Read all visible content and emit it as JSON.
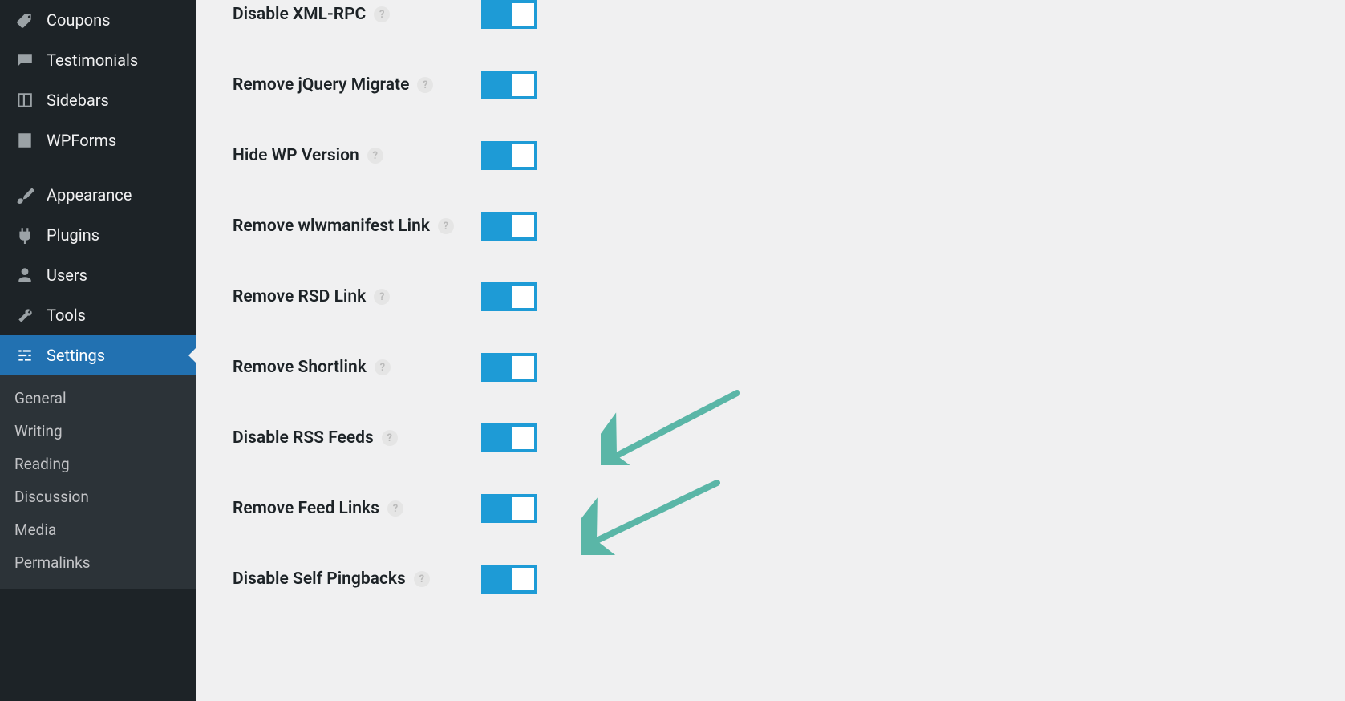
{
  "sidebar": {
    "items": [
      {
        "id": "coupons",
        "label": "Coupons",
        "icon": "tag-icon"
      },
      {
        "id": "testimonials",
        "label": "Testimonials",
        "icon": "testimonial-icon"
      },
      {
        "id": "sidebars",
        "label": "Sidebars",
        "icon": "sidebars-icon"
      },
      {
        "id": "wpforms",
        "label": "WPForms",
        "icon": "wpforms-icon"
      },
      {
        "id": "appearance",
        "label": "Appearance",
        "icon": "brush-icon",
        "spacedTop": true
      },
      {
        "id": "plugins",
        "label": "Plugins",
        "icon": "plugin-icon"
      },
      {
        "id": "users",
        "label": "Users",
        "icon": "user-icon"
      },
      {
        "id": "tools",
        "label": "Tools",
        "icon": "wrench-icon"
      },
      {
        "id": "settings",
        "label": "Settings",
        "icon": "sliders-icon",
        "active": true
      }
    ],
    "submenu": [
      {
        "id": "general",
        "label": "General"
      },
      {
        "id": "writing",
        "label": "Writing"
      },
      {
        "id": "reading",
        "label": "Reading"
      },
      {
        "id": "discussion",
        "label": "Discussion"
      },
      {
        "id": "media",
        "label": "Media"
      },
      {
        "id": "permalinks",
        "label": "Permalinks"
      }
    ]
  },
  "settings": {
    "rows": [
      {
        "id": "disable-xml-rpc",
        "label": "Disable XML-RPC",
        "enabled": true
      },
      {
        "id": "remove-jquery-migrate",
        "label": "Remove jQuery Migrate",
        "enabled": true
      },
      {
        "id": "hide-wp-version",
        "label": "Hide WP Version",
        "enabled": true
      },
      {
        "id": "remove-wlwmanifest-link",
        "label": "Remove wlwmanifest Link",
        "enabled": true
      },
      {
        "id": "remove-rsd-link",
        "label": "Remove RSD Link",
        "enabled": true
      },
      {
        "id": "remove-shortlink",
        "label": "Remove Shortlink",
        "enabled": true
      },
      {
        "id": "disable-rss-feeds",
        "label": "Disable RSS Feeds",
        "enabled": true
      },
      {
        "id": "remove-feed-links",
        "label": "Remove Feed Links",
        "enabled": true
      },
      {
        "id": "disable-self-pingbacks",
        "label": "Disable Self Pingbacks",
        "enabled": true
      }
    ],
    "helpGlyph": "?"
  },
  "annotations": {
    "arrowColor": "#5ab6a7"
  }
}
